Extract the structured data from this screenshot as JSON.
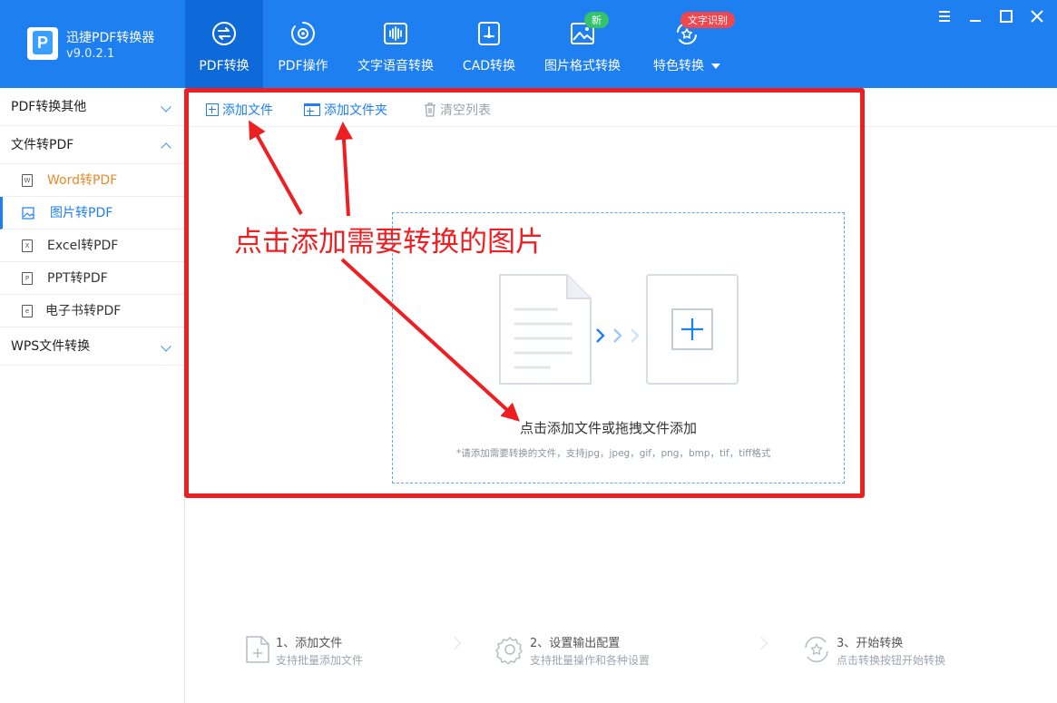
{
  "app": {
    "name": "迅捷PDF转换器",
    "version": "v9.0.2.1"
  },
  "nav": [
    {
      "label": "PDF转换",
      "icon": "swap-circle-icon",
      "active": true
    },
    {
      "label": "PDF操作",
      "icon": "gear-circle-icon"
    },
    {
      "label": "文字语音转换",
      "icon": "audio-wave-icon"
    },
    {
      "label": "CAD转换",
      "icon": "cad-icon"
    },
    {
      "label": "图片格式转换",
      "icon": "image-icon",
      "badge": "新"
    },
    {
      "label": "特色转换",
      "icon": "star-refresh-icon",
      "badge": "文字识别"
    }
  ],
  "window_controls": [
    "menu-icon",
    "minimize-icon",
    "maximize-icon",
    "close-icon"
  ],
  "sidebar": {
    "group1": "PDF转换其他",
    "group2": "文件转PDF",
    "items": [
      {
        "label": "Word转PDF",
        "icon": "W"
      },
      {
        "label": "图片转PDF",
        "icon": "image"
      },
      {
        "label": "Excel转PDF",
        "icon": "X"
      },
      {
        "label": "PPT转PDF",
        "icon": "P"
      },
      {
        "label": "电子书转PDF",
        "icon": "e"
      }
    ],
    "group3": "WPS文件转换"
  },
  "toolbar": {
    "add_file": "添加文件",
    "add_folder": "添加文件夹",
    "clear_list": "清空列表"
  },
  "dropzone": {
    "title": "点击添加文件或拖拽文件添加",
    "hint": "*请添加需要转换的文件，支持jpg，jpeg，gif，png，bmp，tif，tiff格式"
  },
  "annotation": "点击添加需要转换的图片",
  "steps": [
    {
      "title": "1、添加文件",
      "desc": "支持批量添加文件"
    },
    {
      "title": "2、设置输出配置",
      "desc": "支持批量操作和各种设置"
    },
    {
      "title": "3、开始转换",
      "desc": "点击转换按钮开始转换"
    }
  ],
  "colors": {
    "brand": "#1e7ff0",
    "annotation": "#ee1f22",
    "badge_new": "#36c26b",
    "badge_ocr": "#f0474f"
  }
}
